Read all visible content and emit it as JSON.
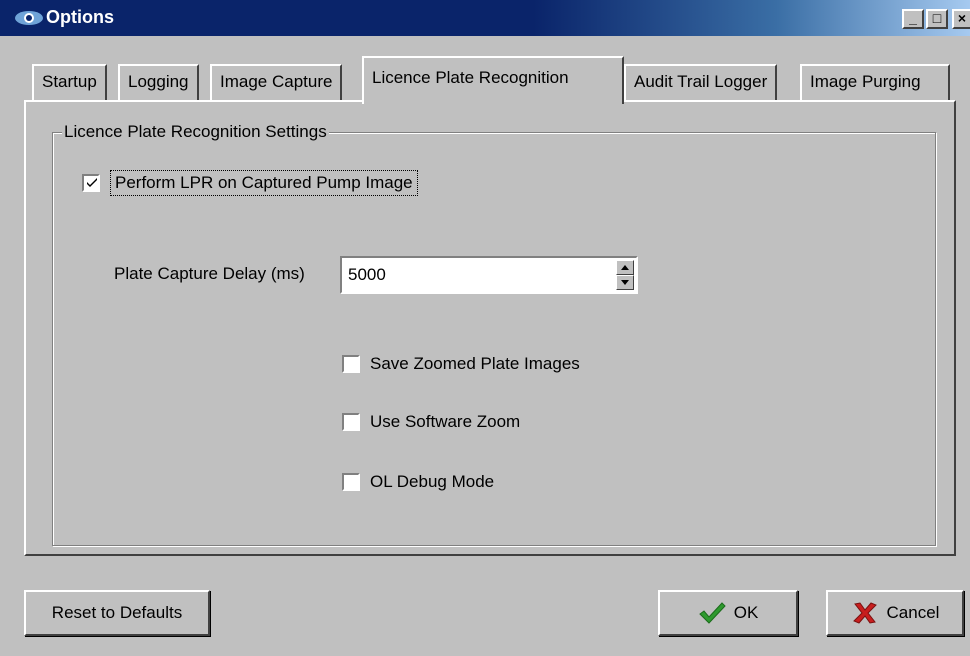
{
  "window": {
    "title": "Options"
  },
  "tabs": [
    {
      "label": "Startup",
      "active": false
    },
    {
      "label": "Logging",
      "active": false
    },
    {
      "label": "Image Capture",
      "active": false
    },
    {
      "label": "Licence Plate Recognition",
      "active": true
    },
    {
      "label": "Audit Trail Logger",
      "active": false
    },
    {
      "label": "Image Purging",
      "active": false
    }
  ],
  "lpr": {
    "group_title": "Licence Plate Recognition Settings",
    "perform_lpr": {
      "label": "Perform LPR on Captured Pump Image",
      "checked": true
    },
    "delay": {
      "label": "Plate Capture Delay (ms)",
      "value": "5000"
    },
    "save_zoomed": {
      "label": "Save Zoomed Plate Images",
      "checked": false
    },
    "software_zoom": {
      "label": "Use Software Zoom",
      "checked": false
    },
    "ol_debug": {
      "label": "OL Debug Mode",
      "checked": false
    }
  },
  "buttons": {
    "reset": "Reset to Defaults",
    "ok": "OK",
    "cancel": "Cancel"
  },
  "icons": {
    "window": "eye-icon",
    "ok": "checkmark-icon",
    "cancel": "x-icon"
  },
  "colors": {
    "titlebar": "#0a246a",
    "face": "#c0c0c0",
    "ok_check": "#2e9a2e",
    "cancel_x": "#c81e1e"
  }
}
